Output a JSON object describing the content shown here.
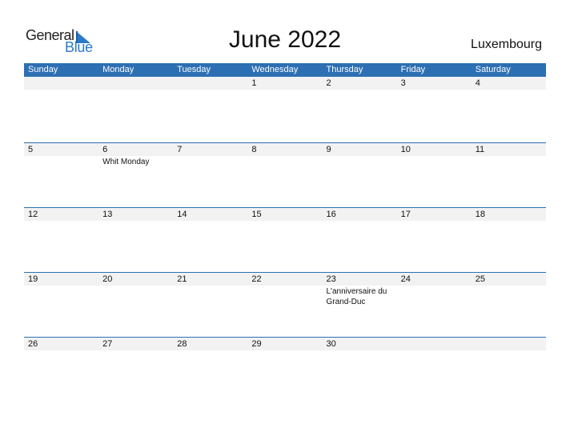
{
  "logo": {
    "line1": "General",
    "line2": "Blue"
  },
  "header": {
    "title": "June 2022",
    "country": "Luxembourg"
  },
  "colors": {
    "accent": "#2d6fb3",
    "band": "#f2f2f2"
  },
  "weekdays": [
    "Sunday",
    "Monday",
    "Tuesday",
    "Wednesday",
    "Thursday",
    "Friday",
    "Saturday"
  ],
  "weeks": [
    {
      "days": [
        "",
        "",
        "",
        "1",
        "2",
        "3",
        "4"
      ],
      "events": [
        "",
        "",
        "",
        "",
        "",
        "",
        ""
      ]
    },
    {
      "days": [
        "5",
        "6",
        "7",
        "8",
        "9",
        "10",
        "11"
      ],
      "events": [
        "",
        "Whit Monday",
        "",
        "",
        "",
        "",
        ""
      ]
    },
    {
      "days": [
        "12",
        "13",
        "14",
        "15",
        "16",
        "17",
        "18"
      ],
      "events": [
        "",
        "",
        "",
        "",
        "",
        "",
        ""
      ]
    },
    {
      "days": [
        "19",
        "20",
        "21",
        "22",
        "23",
        "24",
        "25"
      ],
      "events": [
        "",
        "",
        "",
        "",
        "L'anniversaire du Grand-Duc",
        "",
        ""
      ]
    },
    {
      "days": [
        "26",
        "27",
        "28",
        "29",
        "30",
        "",
        ""
      ],
      "events": [
        "",
        "",
        "",
        "",
        "",
        "",
        ""
      ]
    }
  ]
}
